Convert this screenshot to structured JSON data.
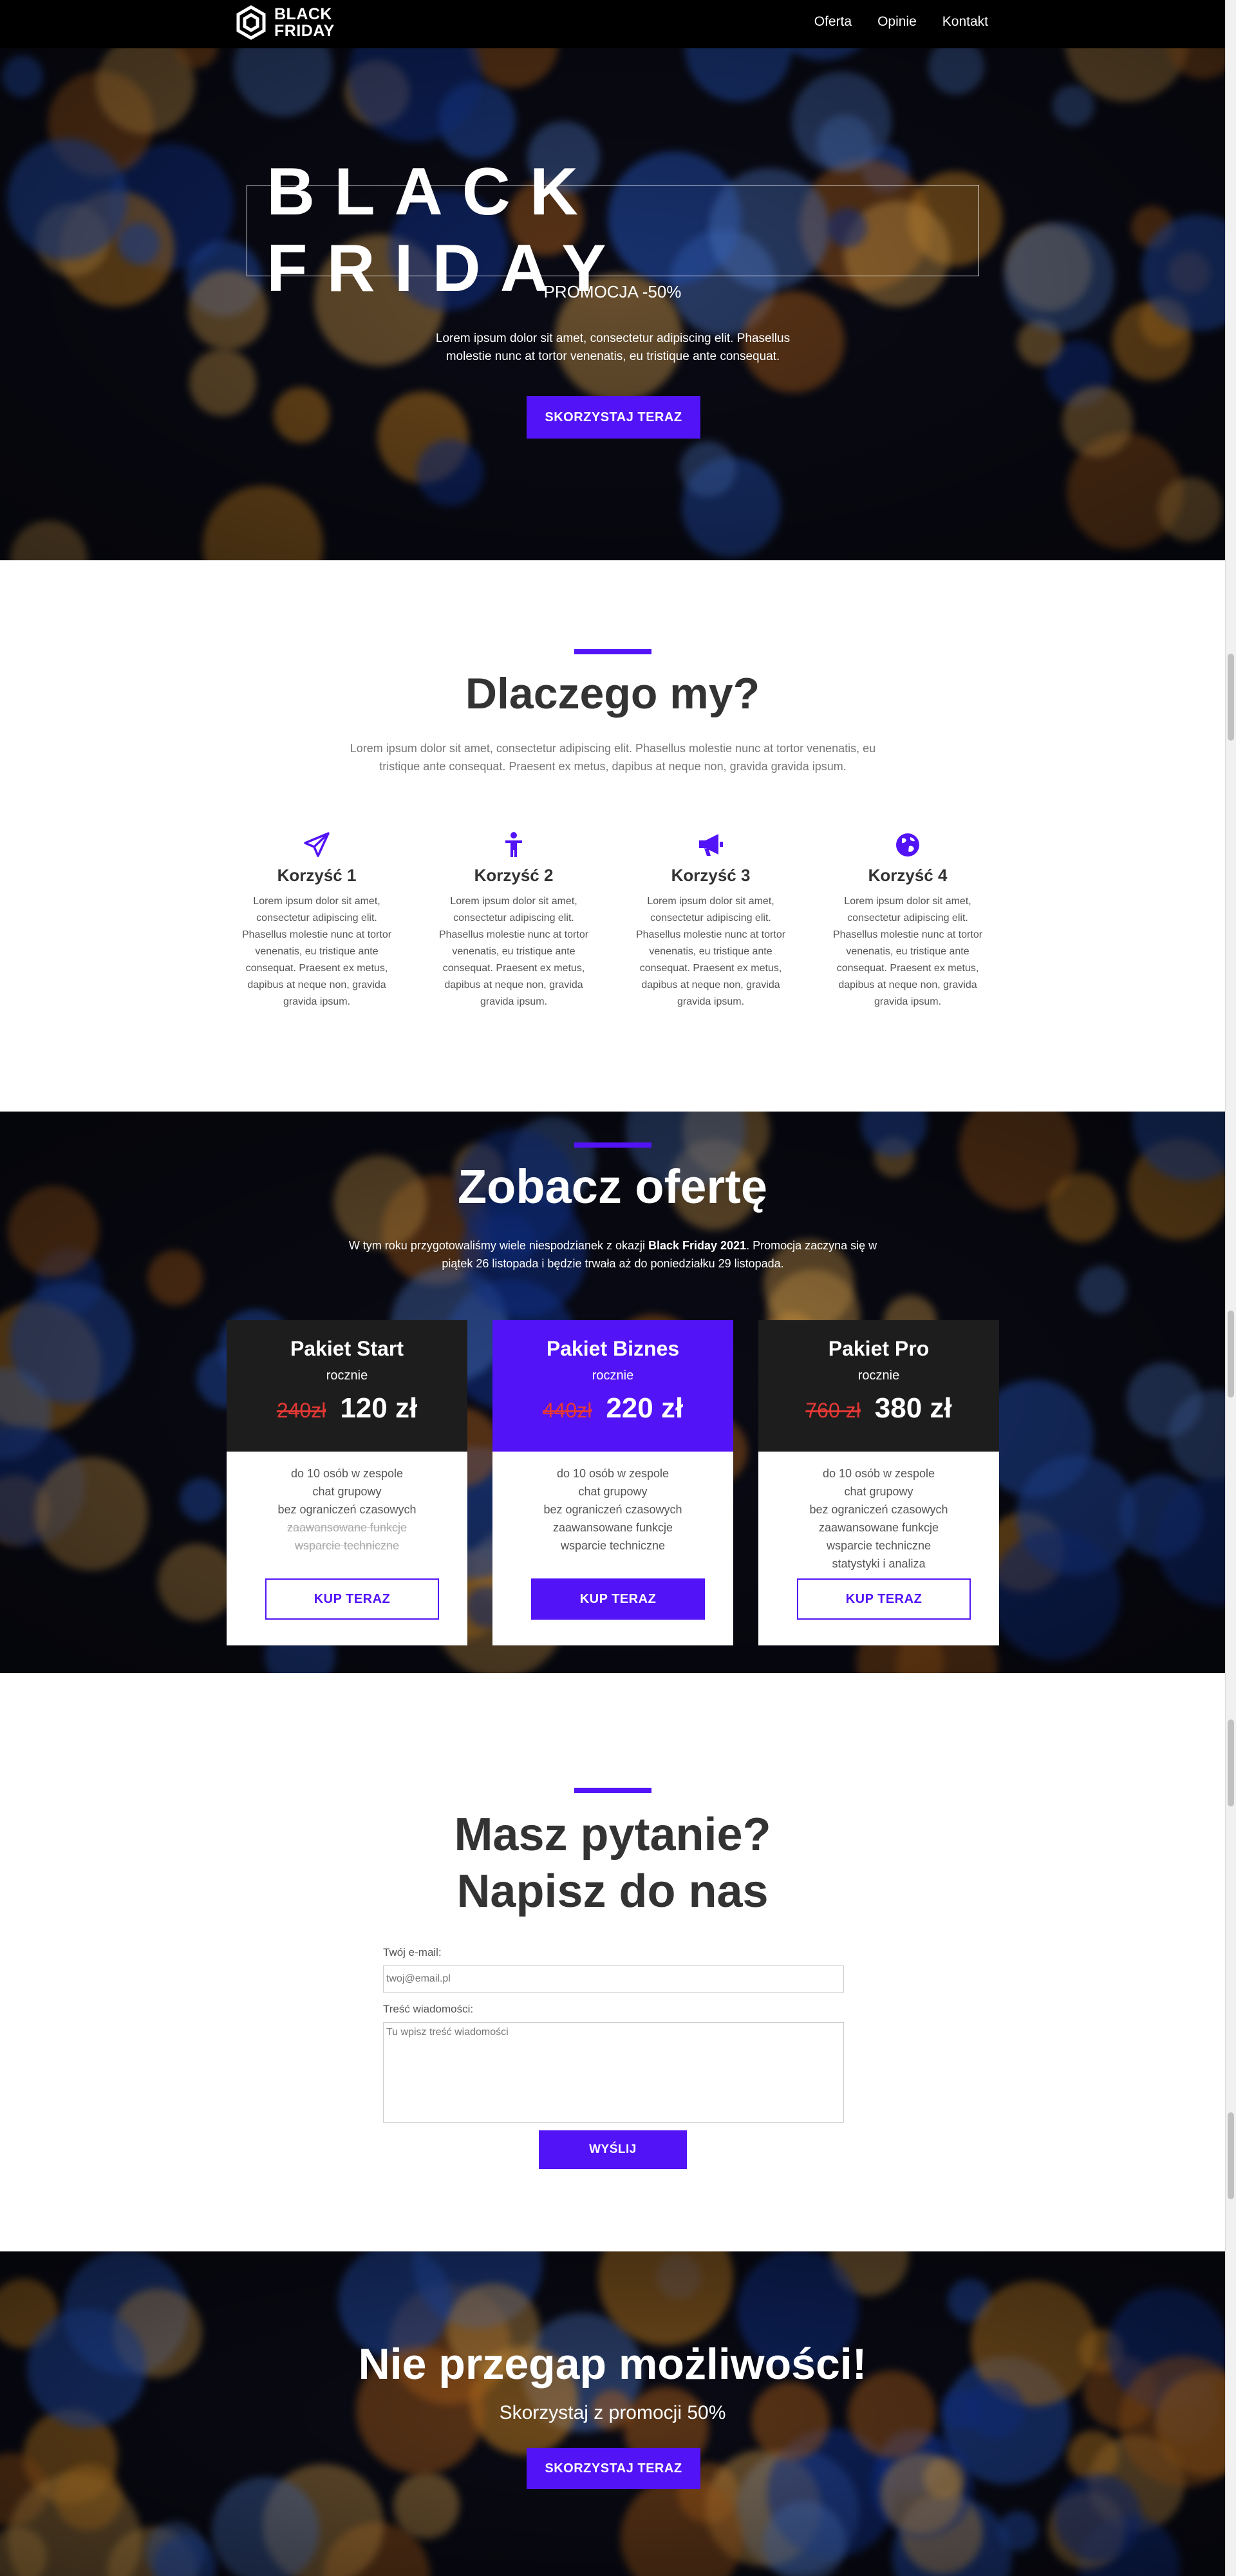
{
  "brand": {
    "line1": "BLACK",
    "line2": "FRIDAY"
  },
  "nav": [
    {
      "label": "Oferta"
    },
    {
      "label": "Opinie"
    },
    {
      "label": "Kontakt"
    }
  ],
  "hero": {
    "title": "BLACK FRIDAY",
    "subtitle": "PROMOCJA -50%",
    "text": "Lorem ipsum dolor sit amet, consectetur adipiscing elit. Phasellus molestie nunc at tortor venenatis, eu tristique ante consequat.",
    "button": "SKORZYSTAJ TERAZ"
  },
  "why": {
    "title": "Dlaczego my?",
    "text": "Lorem ipsum dolor sit amet, consectetur adipiscing elit. Phasellus molestie nunc at tortor venenatis, eu tristique ante consequat. Praesent ex metus, dapibus at neque non, gravida gravida ipsum.",
    "benefits": [
      {
        "icon": "paper-plane-icon",
        "title": "Korzyść 1",
        "text": "Lorem ipsum dolor sit amet, consectetur adipiscing elit. Phasellus molestie nunc at tortor venenatis, eu tristique ante consequat. Praesent ex metus, dapibus at neque non, gravida gravida ipsum."
      },
      {
        "icon": "person-icon",
        "title": "Korzyść 2",
        "text": "Lorem ipsum dolor sit amet, consectetur adipiscing elit. Phasellus molestie nunc at tortor venenatis, eu tristique ante consequat. Praesent ex metus, dapibus at neque non, gravida gravida ipsum."
      },
      {
        "icon": "megaphone-icon",
        "title": "Korzyść 3",
        "text": "Lorem ipsum dolor sit amet, consectetur adipiscing elit. Phasellus molestie nunc at tortor venenatis, eu tristique ante consequat. Praesent ex metus, dapibus at neque non, gravida gravida ipsum."
      },
      {
        "icon": "globe-icon",
        "title": "Korzyść 4",
        "text": "Lorem ipsum dolor sit amet, consectetur adipiscing elit. Phasellus molestie nunc at tortor venenatis, eu tristique ante consequat. Praesent ex metus, dapibus at neque non, gravida gravida ipsum."
      }
    ]
  },
  "offer": {
    "title": "Zobacz ofertę",
    "text_before": "W tym roku przygotowaliśmy wiele niespodzianek z okazji ",
    "text_bold": "Black Friday 2021",
    "text_after": ". Promocja zaczyna się w piątek 26 listopada i będzie trwała aż do poniedziałku 29 listopada.",
    "plans": [
      {
        "name": "Pakiet Start",
        "period": "rocznie",
        "old_price": "240zł",
        "price": "120 zł",
        "button": "KUP TERAZ",
        "features": [
          "do 10 osób w zespole",
          "chat grupowy",
          "bez ograniczeń czasowych",
          "zaawansowane funkcje",
          "wsparcie techniczne"
        ]
      },
      {
        "name": "Pakiet Biznes",
        "period": "rocznie",
        "old_price": "440zł",
        "price": "220 zł",
        "button": "KUP TERAZ",
        "features": [
          "do 10 osób w zespole",
          "chat grupowy",
          "bez ograniczeń czasowych",
          "zaawansowane funkcje",
          "wsparcie techniczne"
        ]
      },
      {
        "name": "Pakiet Pro",
        "period": "rocznie",
        "old_price": "760 zł",
        "price": "380 zł",
        "button": "KUP TERAZ",
        "features": [
          "do 10 osób w zespole",
          "chat grupowy",
          "bez ograniczeń czasowych",
          "zaawansowane funkcje",
          "wsparcie techniczne",
          "statystyki i analiza"
        ]
      }
    ]
  },
  "contact": {
    "title_line1": "Masz pytanie?",
    "title_line2": "Napisz do nas",
    "email_label": "Twój e-mail:",
    "email_placeholder": "twoj@email.pl",
    "message_label": "Treść wiadomości:",
    "message_placeholder": "Tu wpisz treść wiadomości",
    "submit": "WYŚLIJ"
  },
  "cta": {
    "title": "Nie przegap możliwości!",
    "subtitle": "Skorzystaj z promocji 50%",
    "button": "SKORZYSTAJ TERAZ"
  },
  "colors": {
    "accent": "#5313f7",
    "dark": "#000000",
    "strike": "#e53935"
  }
}
